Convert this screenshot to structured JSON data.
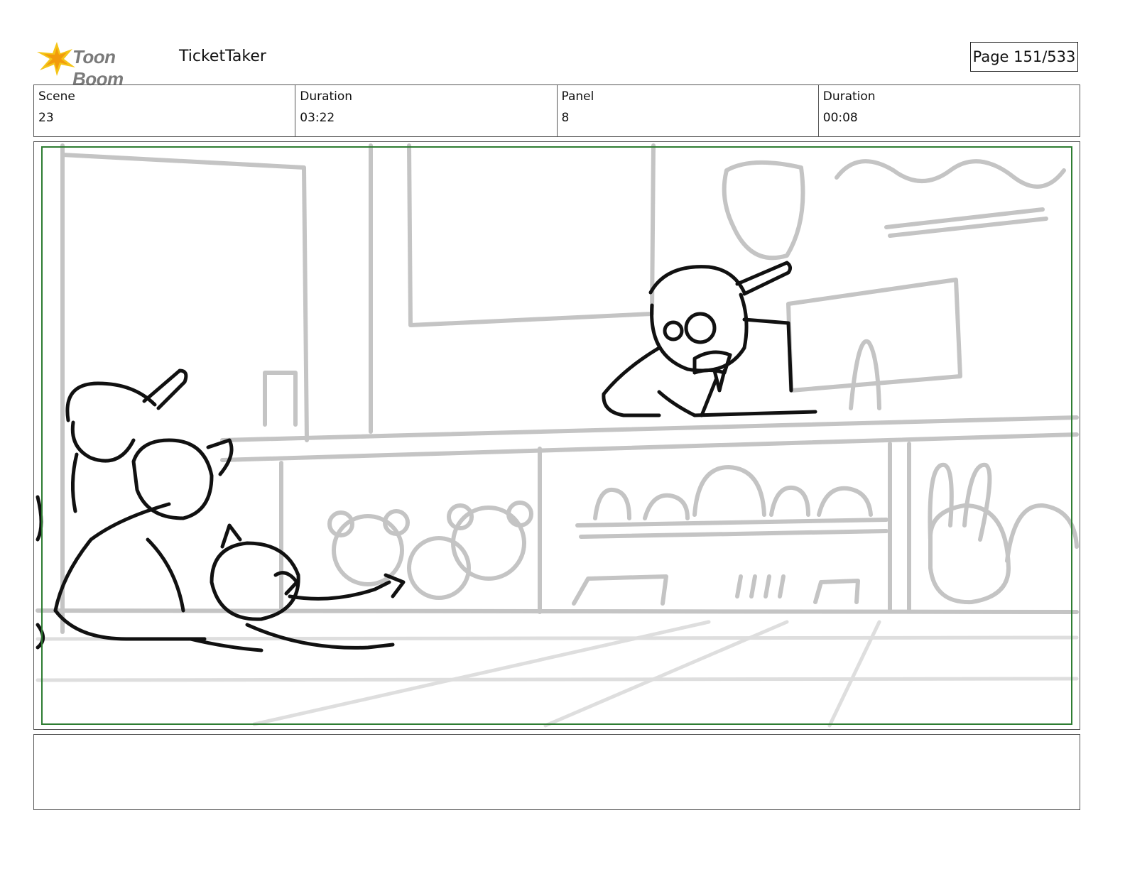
{
  "header": {
    "logo_text": "Toon Boom",
    "project_title": "TicketTaker",
    "page_label": "Page 151/533"
  },
  "info": {
    "scene_label": "Scene",
    "scene_value": "23",
    "scene_duration_label": "Duration",
    "scene_duration_value": "03:22",
    "panel_label": "Panel",
    "panel_value": "8",
    "panel_duration_label": "Duration",
    "panel_duration_value": "00:08"
  },
  "colors": {
    "safe_frame": "#2e7d32",
    "background_sketch": "#c4c4c4",
    "character_ink": "#111111",
    "logo_star": "#f5c518"
  },
  "notes": {
    "text": ""
  }
}
